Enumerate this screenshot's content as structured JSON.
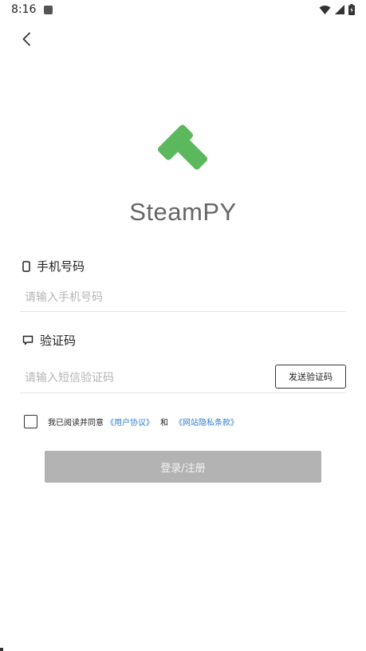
{
  "status_bar": {
    "time": "8:16",
    "icons": [
      "notification-icon",
      "wifi-icon",
      "signal-icon",
      "battery-icon"
    ]
  },
  "nav": {
    "back_icon": "chevron-left-icon"
  },
  "brand": {
    "app_name": "SteamPY",
    "logo_color": "#5cb85c"
  },
  "phone": {
    "label": "手机号码",
    "icon": "phone-icon",
    "placeholder": "请输入手机号码",
    "value": ""
  },
  "code": {
    "label": "验证码",
    "icon": "message-icon",
    "placeholder": "请输入短信验证码",
    "value": "",
    "send_button": "发送验证码"
  },
  "agreement": {
    "checked": false,
    "prefix": "我已阅读并同意",
    "user_agreement": "《用户协议》",
    "and": "和",
    "privacy_policy": "《网站隐私条款》",
    "link_color": "#2f7fd0"
  },
  "submit": {
    "label": "登录/注册",
    "color": "#b3b3b3"
  }
}
